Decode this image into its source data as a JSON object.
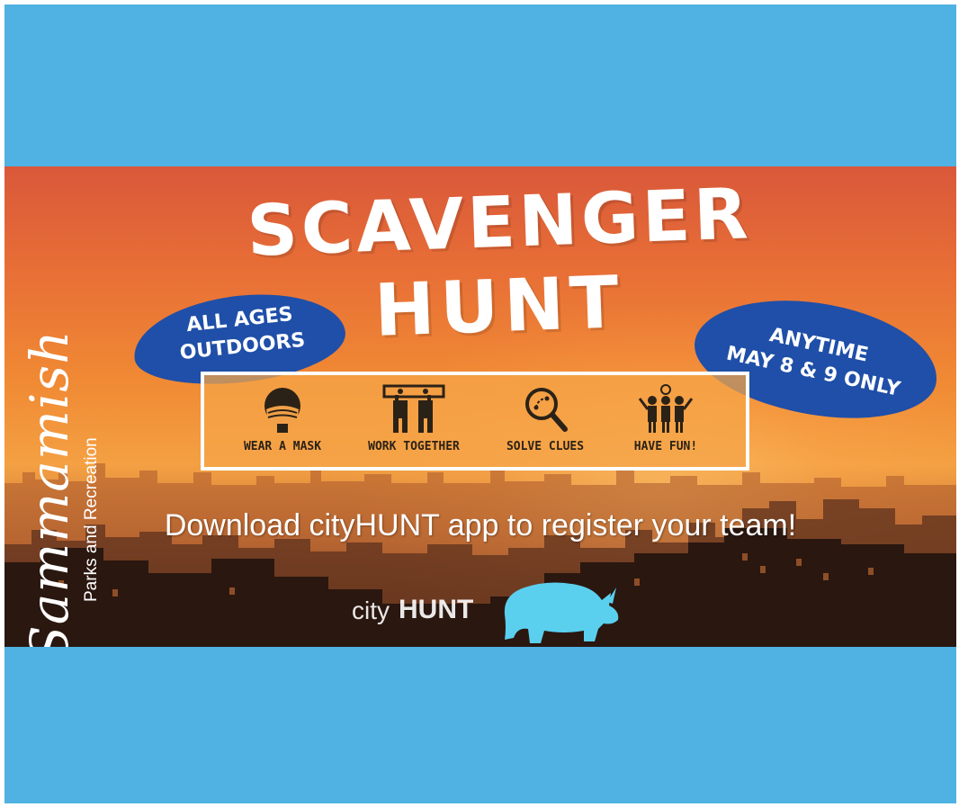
{
  "page": {
    "background_color": "#4fb2e2"
  },
  "logo": {
    "script_text": "Sammamish",
    "subtitle": "Parks and Recreation"
  },
  "title": {
    "line1": "SCAVENGER",
    "line2": "HUNT"
  },
  "badges": {
    "left": {
      "line1": "ALL AGES",
      "line2": "OUTDOORS",
      "color": "#1f4fa8"
    },
    "right": {
      "line1": "ANYTIME",
      "line2": "MAY 8 & 9 ONLY",
      "color": "#1f4fa8"
    }
  },
  "rules": [
    {
      "label": "WEAR A MASK",
      "icon": "mask-icon"
    },
    {
      "label": "WORK TOGETHER",
      "icon": "teamwork-icon"
    },
    {
      "label": "SOLVE CLUES",
      "icon": "magnifier-icon"
    },
    {
      "label": "HAVE FUN!",
      "icon": "celebration-icon"
    }
  ],
  "cta": {
    "text": "Download cityHUNT app to register your team!"
  },
  "brand": {
    "city": "city",
    "hunt": "HUNT",
    "rhino_color": "#5ad0ee"
  }
}
